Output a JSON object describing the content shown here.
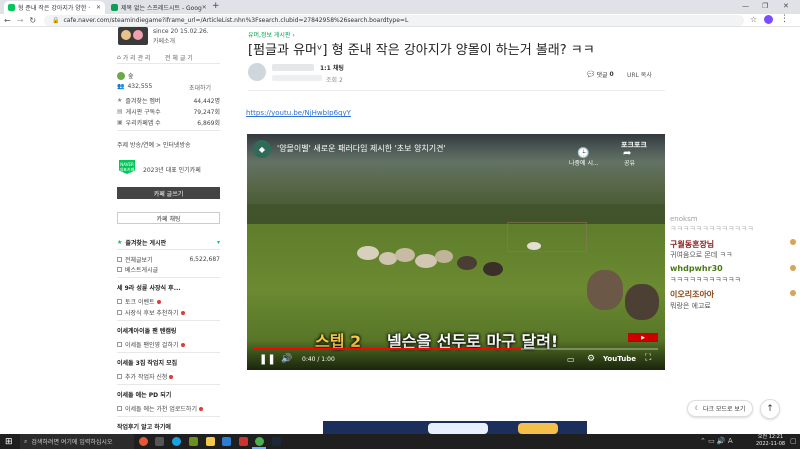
{
  "browser": {
    "tabs": [
      {
        "title": "형 준내 작은 강아지가 양한 ·",
        "active": true
      },
      {
        "title": "제목 없는 스프레드시트 - Goog",
        "active": false
      }
    ],
    "new_tab": "+",
    "url": "cafe.naver.com/steamindiegame?iframe_url=/ArticleList.nhn%3Fsearch.clubid=27842958%26search.boardtype=L"
  },
  "sidebar": {
    "cafe_date": "since 20 15.02.26.",
    "cafe_intro": "카페소개",
    "cafe_manage": "가 리 관 리",
    "cafe_chat": "전 체 글 기",
    "member_label": "숲",
    "member_count": "432,555",
    "invite": "초대하기",
    "stats": [
      {
        "label": "즐겨찾는 멤버",
        "value": "44,442명"
      },
      {
        "label": "게시판 구독수",
        "value": "79,247회"
      },
      {
        "label": "우리카페앱 수",
        "value": "6,869회"
      }
    ],
    "theme_line": "주제 방송/연예 > 인터넷방송",
    "badge_text": "NAVER 대표카페",
    "badge_caption": "2023년 대표 인기카페",
    "write_button": "카페 글쓰기",
    "chat_button": "카페 채팅",
    "fav_header": "즐겨찾는 게시판",
    "boards": [
      {
        "name": "전체글보기",
        "count": "6,522,687",
        "dot": false
      },
      {
        "name": "베스트게시글",
        "count": "",
        "dot": false
      }
    ],
    "sections": [
      {
        "title": "세 9라 성륜 사장식 후...",
        "items": [
          {
            "name": "토크 이벤트",
            "dot": true
          },
          {
            "name": "사장식 후보 추천하기",
            "dot": true
          }
        ]
      },
      {
        "title": "이세계아이돌 팬 텐캠링",
        "items": [
          {
            "name": "이세돌 팬인영 걸하기",
            "dot": true
          }
        ]
      },
      {
        "title": "이세돌 3집 작업지 모집",
        "items": [
          {
            "name": "추가 작업자 신청",
            "dot": true
          }
        ]
      },
      {
        "title": "이세돌 에는 PD 되기",
        "items": [
          {
            "name": "이세돌 에는 가천 업로드하기",
            "dot": true
          }
        ]
      },
      {
        "title": "작업후기 알고 하기에",
        "items": []
      }
    ]
  },
  "article": {
    "breadcrumb": "유머,정보 게시판",
    "title": "[펌글과 유머ᵛ] 형 준내 작은 강아지가 양몰이 하는거 볼래? ㅋㅋ",
    "rank": "1:1 채팅",
    "meta": "조회 2",
    "comments_label": "댓글",
    "comments_count": "0",
    "url_copy": "URL 복사",
    "link": "https://youtu.be/NjHwbIp6qyY"
  },
  "video": {
    "title": "'양몰이벨' 새로운 패러다임 제시한 '초보 양치기견'",
    "channel_logo": "포크포크",
    "share": "공유",
    "watch_later": "나중에 시...",
    "subtitle_part1": "스텝 2",
    "subtitle_part2": "넬슨을 선두로 마구 달려!",
    "time": "0:40 / 1:00",
    "progress": 0.66,
    "brand": "YouTube"
  },
  "chat": [
    {
      "name": "enoksm",
      "msg": "ㅋㅋㅋㅋㅋㅋㅋㅋㅋㅋㅋㅋㅋ",
      "color": "#9aa0a6"
    },
    {
      "name": "구월동혼장님",
      "msg": "귀여움으로 몬데 ㅋㅋ",
      "color": "#8b1a1a"
    },
    {
      "name": "whdpwhr30",
      "msg": "ㅋㅋㅋㅋㅋㅋㅋㅋㅋㅋㅋ",
      "color": "#4a7a12"
    },
    {
      "name": "이오리조아아",
      "msg": "뭐랑은 에고료",
      "color": "#8b4513"
    }
  ],
  "dark_mode_button": "다크 모드로 보기",
  "taskbar": {
    "search_placeholder": "검색하려면 여기에 입력하십시오",
    "time": "오전 12:21",
    "date": "2022-11-08"
  }
}
